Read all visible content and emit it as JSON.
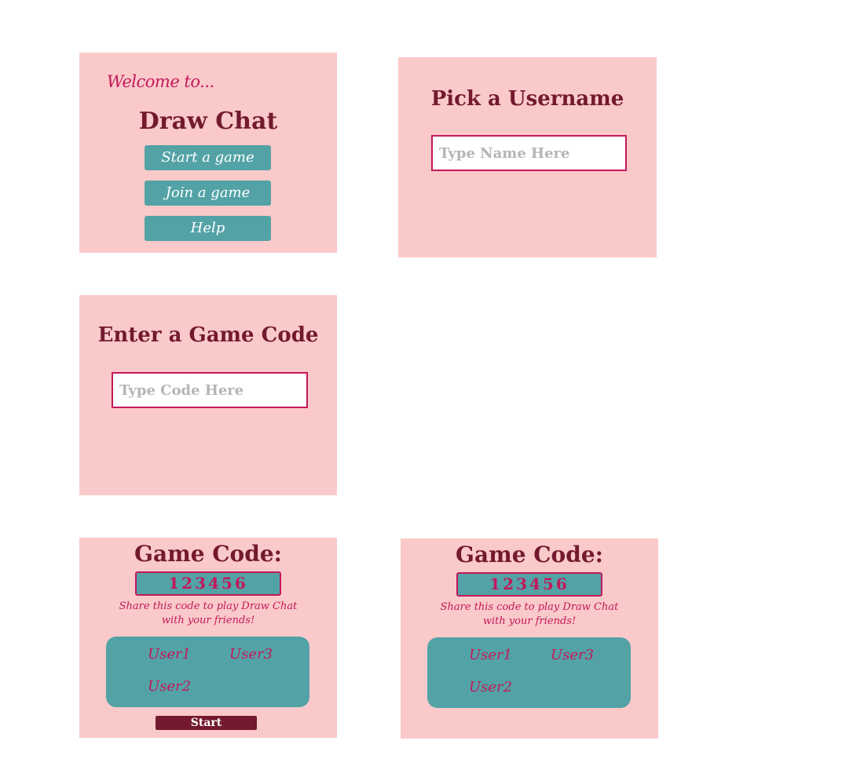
{
  "welcome_screen": {
    "welcome_text": "Welcome to...",
    "title": "Draw Chat",
    "buttons": [
      "Start a game",
      "Join a game",
      "Help"
    ]
  },
  "username_screen": {
    "heading": "Pick a Username",
    "input_placeholder": "Type Name Here"
  },
  "join_screen": {
    "heading": "Enter a Game Code",
    "input_placeholder": "Type Code Here"
  },
  "lobby_host": {
    "title": "Game Code:",
    "code": "123456",
    "share_line1": "Share this code to play Draw Chat",
    "share_line2": "with your friends!",
    "users": [
      "User1",
      "User3",
      "User2"
    ],
    "start_label": "Start"
  },
  "lobby_guest": {
    "title": "Game Code:",
    "code": "123456",
    "share_line1": "Share this code to play Draw Chat",
    "share_line2": "with your friends!",
    "users": [
      "User1",
      "User3",
      "User2"
    ]
  },
  "colors": {
    "panel_bg": "#fac9c9",
    "dark_maroon": "#731a2e",
    "magenta": "#c2185b",
    "teal": "#53a3a6"
  }
}
